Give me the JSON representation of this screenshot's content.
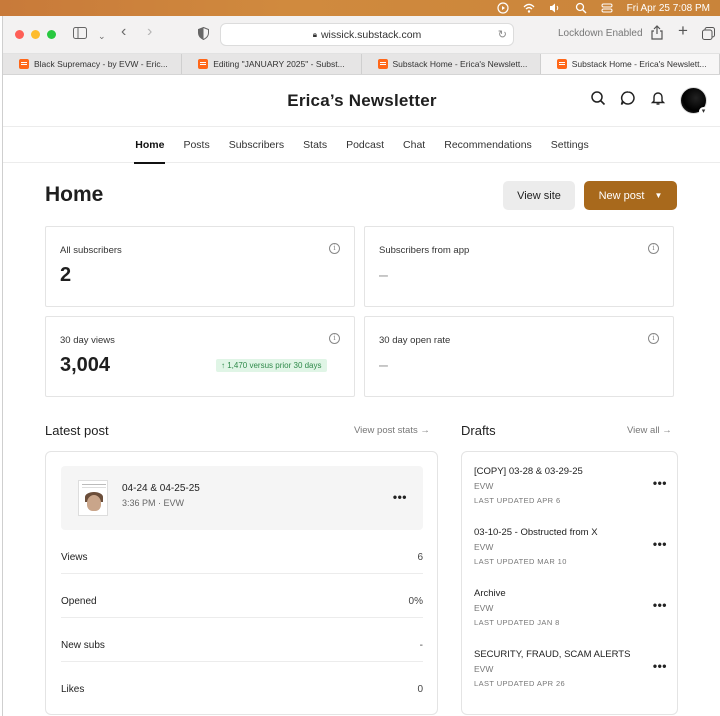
{
  "menubar": {
    "datetime": "Fri Apr 25  7:08 PM"
  },
  "browser": {
    "url": "wissick.substack.com",
    "lockdown": "Lockdown Enabled",
    "tabs": [
      {
        "label": "Black Supremacy - by EVW - Eric..."
      },
      {
        "label": "Editing \"JANUARY 2025\" - Subst..."
      },
      {
        "label": "Substack Home - Erica's Newslett..."
      },
      {
        "label": "Substack Home - Erica's Newslett..."
      }
    ]
  },
  "site": {
    "title": "Erica’s Newsletter"
  },
  "nav": {
    "items": [
      {
        "label": "Home"
      },
      {
        "label": "Posts"
      },
      {
        "label": "Subscribers"
      },
      {
        "label": "Stats"
      },
      {
        "label": "Podcast"
      },
      {
        "label": "Chat"
      },
      {
        "label": "Recommendations"
      },
      {
        "label": "Settings"
      }
    ]
  },
  "home": {
    "title": "Home",
    "view_site": "View site",
    "new_post": "New post"
  },
  "cards": [
    {
      "label": "All subscribers",
      "value": "2"
    },
    {
      "label": "Subscribers from app",
      "value": "–"
    },
    {
      "label": "30 day views",
      "value": "3,004",
      "badge": "1,470 versus prior 30 days"
    },
    {
      "label": "30 day open rate",
      "value": "–"
    }
  ],
  "latest": {
    "title": "Latest post",
    "link": "View post stats",
    "post_title": "04-24 & 04-25-25",
    "post_meta": "3:36 PM · EVW",
    "stats": [
      {
        "label": "Views",
        "value": "6"
      },
      {
        "label": "Opened",
        "value": "0%"
      },
      {
        "label": "New subs",
        "value": "-"
      },
      {
        "label": "Likes",
        "value": "0"
      }
    ]
  },
  "drafts": {
    "title": "Drafts",
    "link": "View all",
    "items": [
      {
        "title": "[COPY] 03-28 & 03-29-25",
        "author": "EVW",
        "updated": "LAST UPDATED APR 6"
      },
      {
        "title": "03-10-25 - Obstructed from X",
        "author": "EVW",
        "updated": "LAST UPDATED MAR 10"
      },
      {
        "title": "Archive",
        "author": "EVW",
        "updated": "LAST UPDATED JAN 8"
      },
      {
        "title": "SECURITY, FRAUD, SCAM ALERTS",
        "author": "EVW",
        "updated": "LAST UPDATED APR 26"
      }
    ]
  },
  "colors": {
    "accent": "#a8691c",
    "badge_bg": "#e0f5e6",
    "badge_text": "#2f8a4a"
  }
}
